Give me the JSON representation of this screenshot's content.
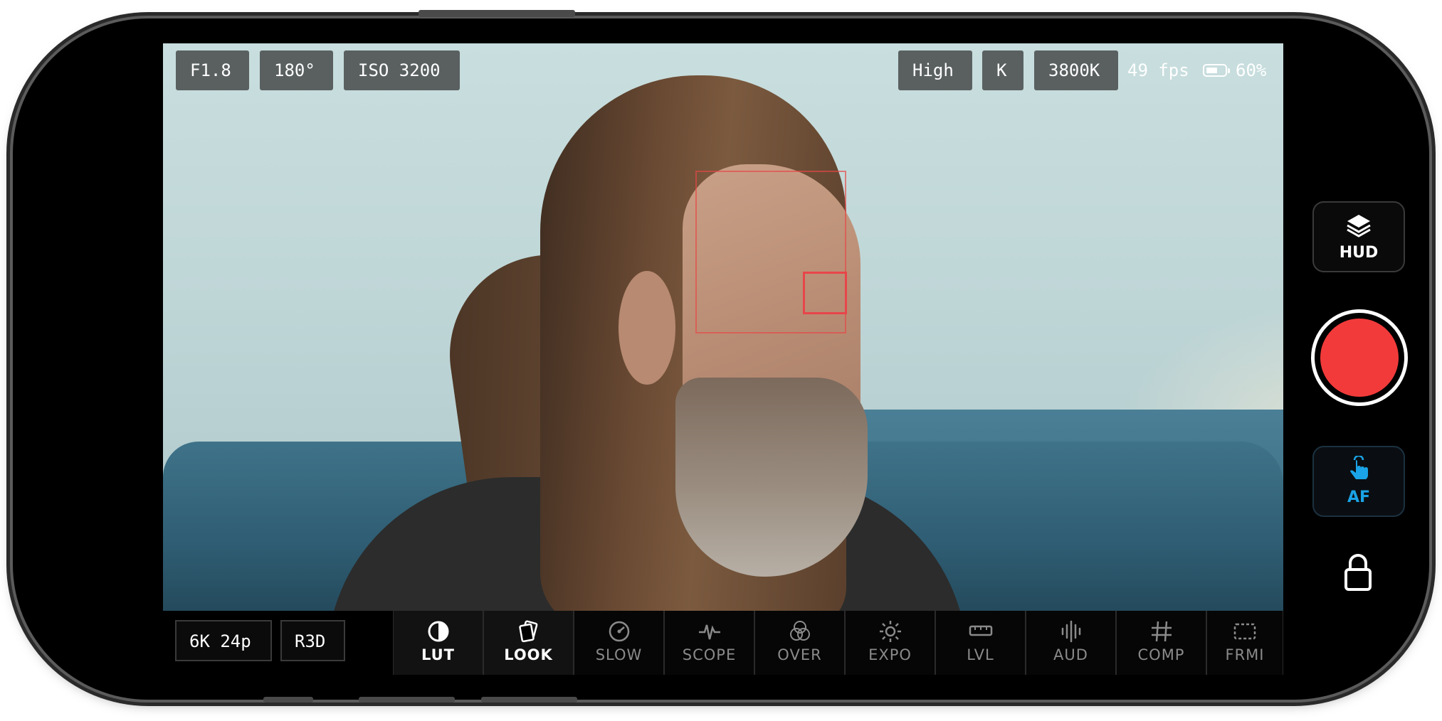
{
  "top_left": {
    "aperture": "F1.8",
    "shutter": "180°",
    "iso": "ISO 3200"
  },
  "top_right": {
    "quality": "High",
    "wb_mode": "K",
    "white_balance": "3800K",
    "fps": "49 fps",
    "battery_percent": "60%",
    "battery_level": 0.6
  },
  "bottom_left": {
    "resolution": "6K 24p",
    "codec": "R3D"
  },
  "tools": [
    {
      "label": "LUT",
      "icon": "half-circle-icon",
      "active": true
    },
    {
      "label": "LOOK",
      "icon": "layers-look-icon",
      "active": true
    },
    {
      "label": "SLOW",
      "icon": "speedometer-icon",
      "active": false
    },
    {
      "label": "SCOPE",
      "icon": "waveform-icon",
      "active": false
    },
    {
      "label": "OVER",
      "icon": "overlay-circles-icon",
      "active": false
    },
    {
      "label": "EXPO",
      "icon": "sun-icon",
      "active": false
    },
    {
      "label": "LVL",
      "icon": "level-icon",
      "active": false
    },
    {
      "label": "AUD",
      "icon": "audio-bars-icon",
      "active": false
    },
    {
      "label": "COMP",
      "icon": "grid-hash-icon",
      "active": false
    },
    {
      "label": "FRMI",
      "icon": "frame-dashed-icon",
      "active": false
    }
  ],
  "side": {
    "hud_label": "HUD",
    "af_label": "AF"
  },
  "colors": {
    "record": "#f23a3a",
    "af_accent": "#1aa3e6",
    "focus_box": "#e8454a"
  }
}
